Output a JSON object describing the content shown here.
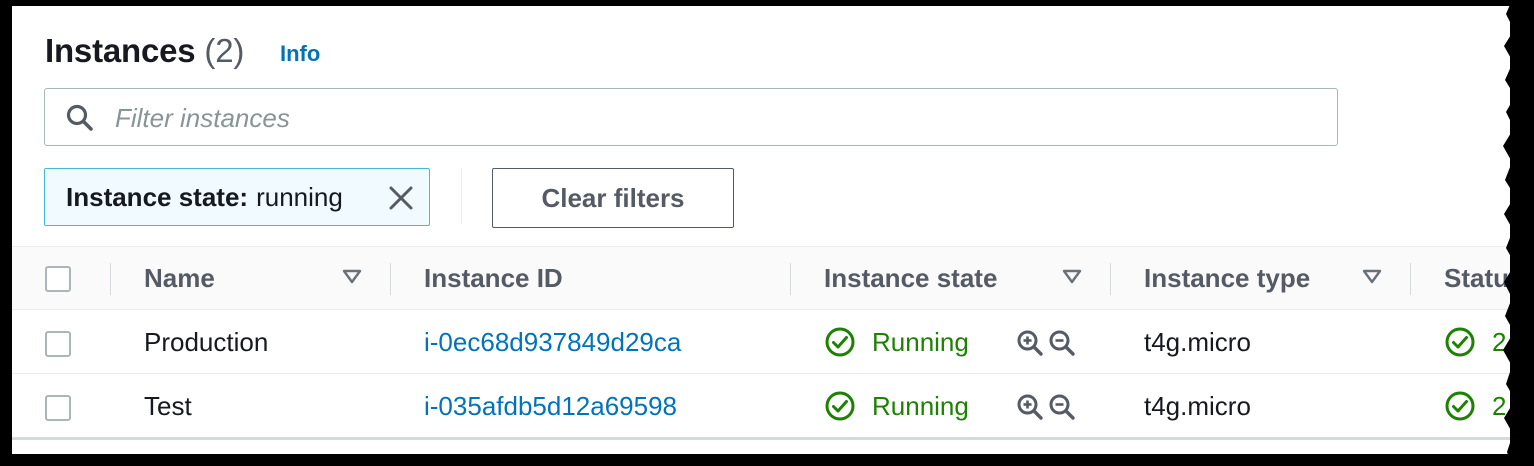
{
  "header": {
    "title": "Instances",
    "count": "(2)",
    "info_link": "Info"
  },
  "search": {
    "placeholder": "Filter instances",
    "value": ""
  },
  "filter_token": {
    "key": "Instance state:",
    "value": "running"
  },
  "clear_filters_label": "Clear filters",
  "table": {
    "columns": [
      {
        "label": "Name",
        "sortable": true
      },
      {
        "label": "Instance ID",
        "sortable": false
      },
      {
        "label": "Instance state",
        "sortable": true
      },
      {
        "label": "Instance type",
        "sortable": true
      },
      {
        "label": "Statu",
        "sortable": false
      }
    ],
    "rows": [
      {
        "name": "Production",
        "instance_id": "i-0ec68d937849d29ca",
        "state": "Running",
        "type": "t4g.micro",
        "status": "2/"
      },
      {
        "name": "Test",
        "instance_id": "i-035afdb5d12a69598",
        "state": "Running",
        "type": "t4g.micro",
        "status": "2"
      }
    ]
  },
  "colors": {
    "link": "#0073bb",
    "success": "#1d8102",
    "token_border": "#44b9d6",
    "token_bg": "#f1faff"
  },
  "icons": [
    "search-icon",
    "close-icon",
    "caret-down-icon",
    "check-circle-icon",
    "zoom-in-icon",
    "zoom-out-icon"
  ]
}
